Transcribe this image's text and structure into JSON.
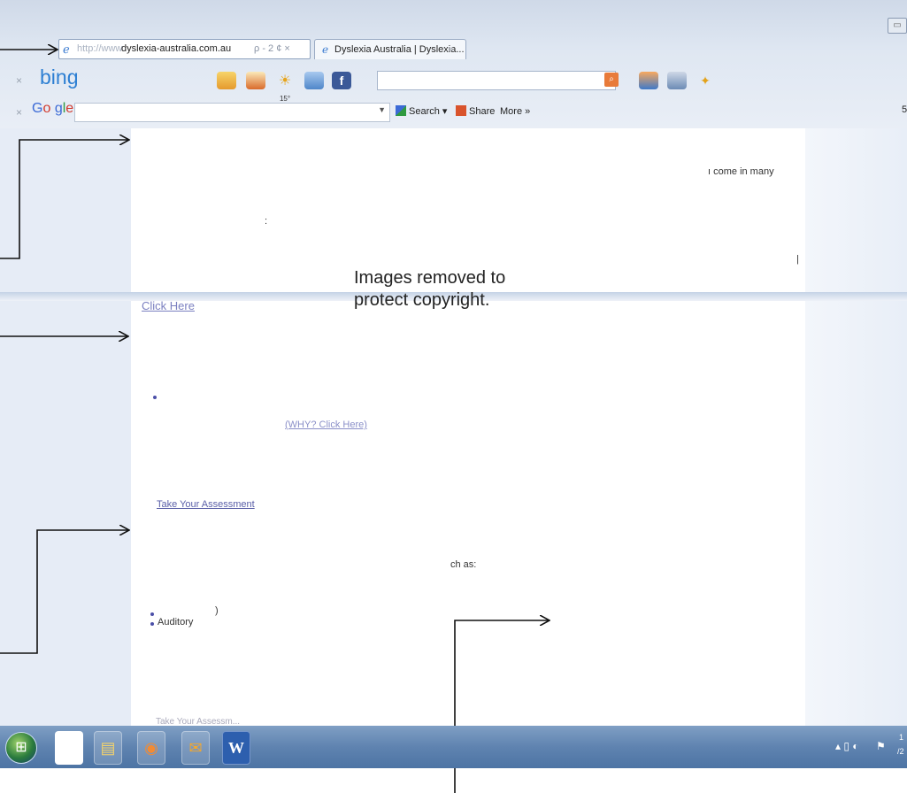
{
  "browser": {
    "url_prefix": "http://www.",
    "url_host": "dyslexia-australia.com.au",
    "addr_tools": "ρ - 2 ¢ ×",
    "tab_title": "Dyslexia Australia | Dyslexia...",
    "tab_close": "×"
  },
  "bing_toolbar": {
    "logo": "bing",
    "close": "×",
    "weather_temp": "15°",
    "facebook": "f"
  },
  "google_toolbar": {
    "close": "×",
    "search_label": "Search",
    "share_label": "Share",
    "more_label": "More »",
    "edge_char": "5"
  },
  "page": {
    "snippet_top": "ı come in many",
    "click_here": "Click Here",
    "why_click_here": "(WHY? Click Here)",
    "take_assessment": "Take Your Assessment",
    "such_as": "ch as:",
    "paren": ")",
    "auditory": "Auditory",
    "bottom_partial": "Take Your Assessm..."
  },
  "notice": {
    "line1": "Images removed to",
    "line2": "protect copyright."
  },
  "taskbar": {
    "clock_partial": "1",
    "date_partial": "/2"
  }
}
